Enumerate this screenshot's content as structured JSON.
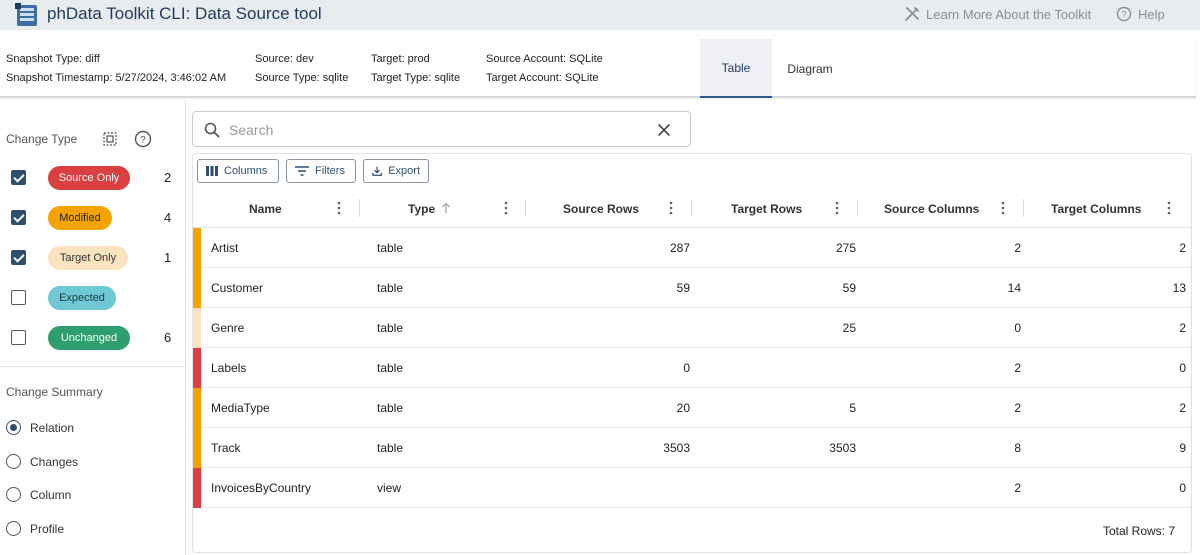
{
  "app": {
    "title": "phData Toolkit CLI: Data Source tool",
    "learn_more": "Learn More About the Toolkit",
    "help": "Help"
  },
  "snapshot": {
    "type": "Snapshot Type: diff",
    "timestamp": "Snapshot Timestamp: 5/27/2024, 3:46:02 AM",
    "source": "Source: dev",
    "source_type": "Source Type: sqlite",
    "target": "Target: prod",
    "target_type": "Target Type: sqlite",
    "source_account": "Source Account: SQLite",
    "target_account": "Target Account: SQLite"
  },
  "tabs": [
    {
      "label": "Table",
      "active": true
    },
    {
      "label": "Diagram",
      "active": false
    }
  ],
  "sidebar": {
    "change_type_heading": "Change Type",
    "change_types": [
      {
        "label": "Source Only",
        "checked": true,
        "count": "2",
        "bg": "#d9403f",
        "fg": "#ffffff"
      },
      {
        "label": "Modified",
        "checked": true,
        "count": "4",
        "bg": "#f5a300",
        "fg": "#222222"
      },
      {
        "label": "Target Only",
        "checked": true,
        "count": "1",
        "bg": "#fbe3c0",
        "fg": "#333333"
      },
      {
        "label": "Expected",
        "checked": false,
        "count": "",
        "bg": "#6fc8d6",
        "fg": "#1d3b44"
      },
      {
        "label": "Unchanged",
        "checked": false,
        "count": "6",
        "bg": "#2e9e6e",
        "fg": "#ffffff"
      }
    ],
    "change_summary_heading": "Change Summary",
    "summary_options": [
      {
        "label": "Relation",
        "selected": true
      },
      {
        "label": "Changes",
        "selected": false
      },
      {
        "label": "Column",
        "selected": false
      },
      {
        "label": "Profile",
        "selected": false
      }
    ]
  },
  "search": {
    "placeholder": "Search",
    "value": ""
  },
  "toolbar": {
    "columns": "Columns",
    "filters": "Filters",
    "export": "Export"
  },
  "table": {
    "columns": [
      "Name",
      "Type",
      "Source Rows",
      "Target Rows",
      "Source Columns",
      "Target Columns"
    ],
    "rows": [
      {
        "name": "Artist",
        "type": "table",
        "source_rows": "287",
        "target_rows": "275",
        "source_columns": "2",
        "target_columns": "2",
        "status_color": "#f5a300"
      },
      {
        "name": "Customer",
        "type": "table",
        "source_rows": "59",
        "target_rows": "59",
        "source_columns": "14",
        "target_columns": "13",
        "status_color": "#f5a300"
      },
      {
        "name": "Genre",
        "type": "table",
        "source_rows": "",
        "target_rows": "25",
        "source_columns": "0",
        "target_columns": "2",
        "status_color": "#fbe3c0"
      },
      {
        "name": "Labels",
        "type": "table",
        "source_rows": "0",
        "target_rows": "",
        "source_columns": "2",
        "target_columns": "0",
        "status_color": "#d9403f"
      },
      {
        "name": "MediaType",
        "type": "table",
        "source_rows": "20",
        "target_rows": "5",
        "source_columns": "2",
        "target_columns": "2",
        "status_color": "#f5a300"
      },
      {
        "name": "Track",
        "type": "table",
        "source_rows": "3503",
        "target_rows": "3503",
        "source_columns": "8",
        "target_columns": "9",
        "status_color": "#f5a300"
      },
      {
        "name": "InvoicesByCountry",
        "type": "view",
        "source_rows": "",
        "target_rows": "",
        "source_columns": "2",
        "target_columns": "0",
        "status_color": "#d9403f"
      }
    ],
    "total_rows": "Total Rows: 7"
  }
}
